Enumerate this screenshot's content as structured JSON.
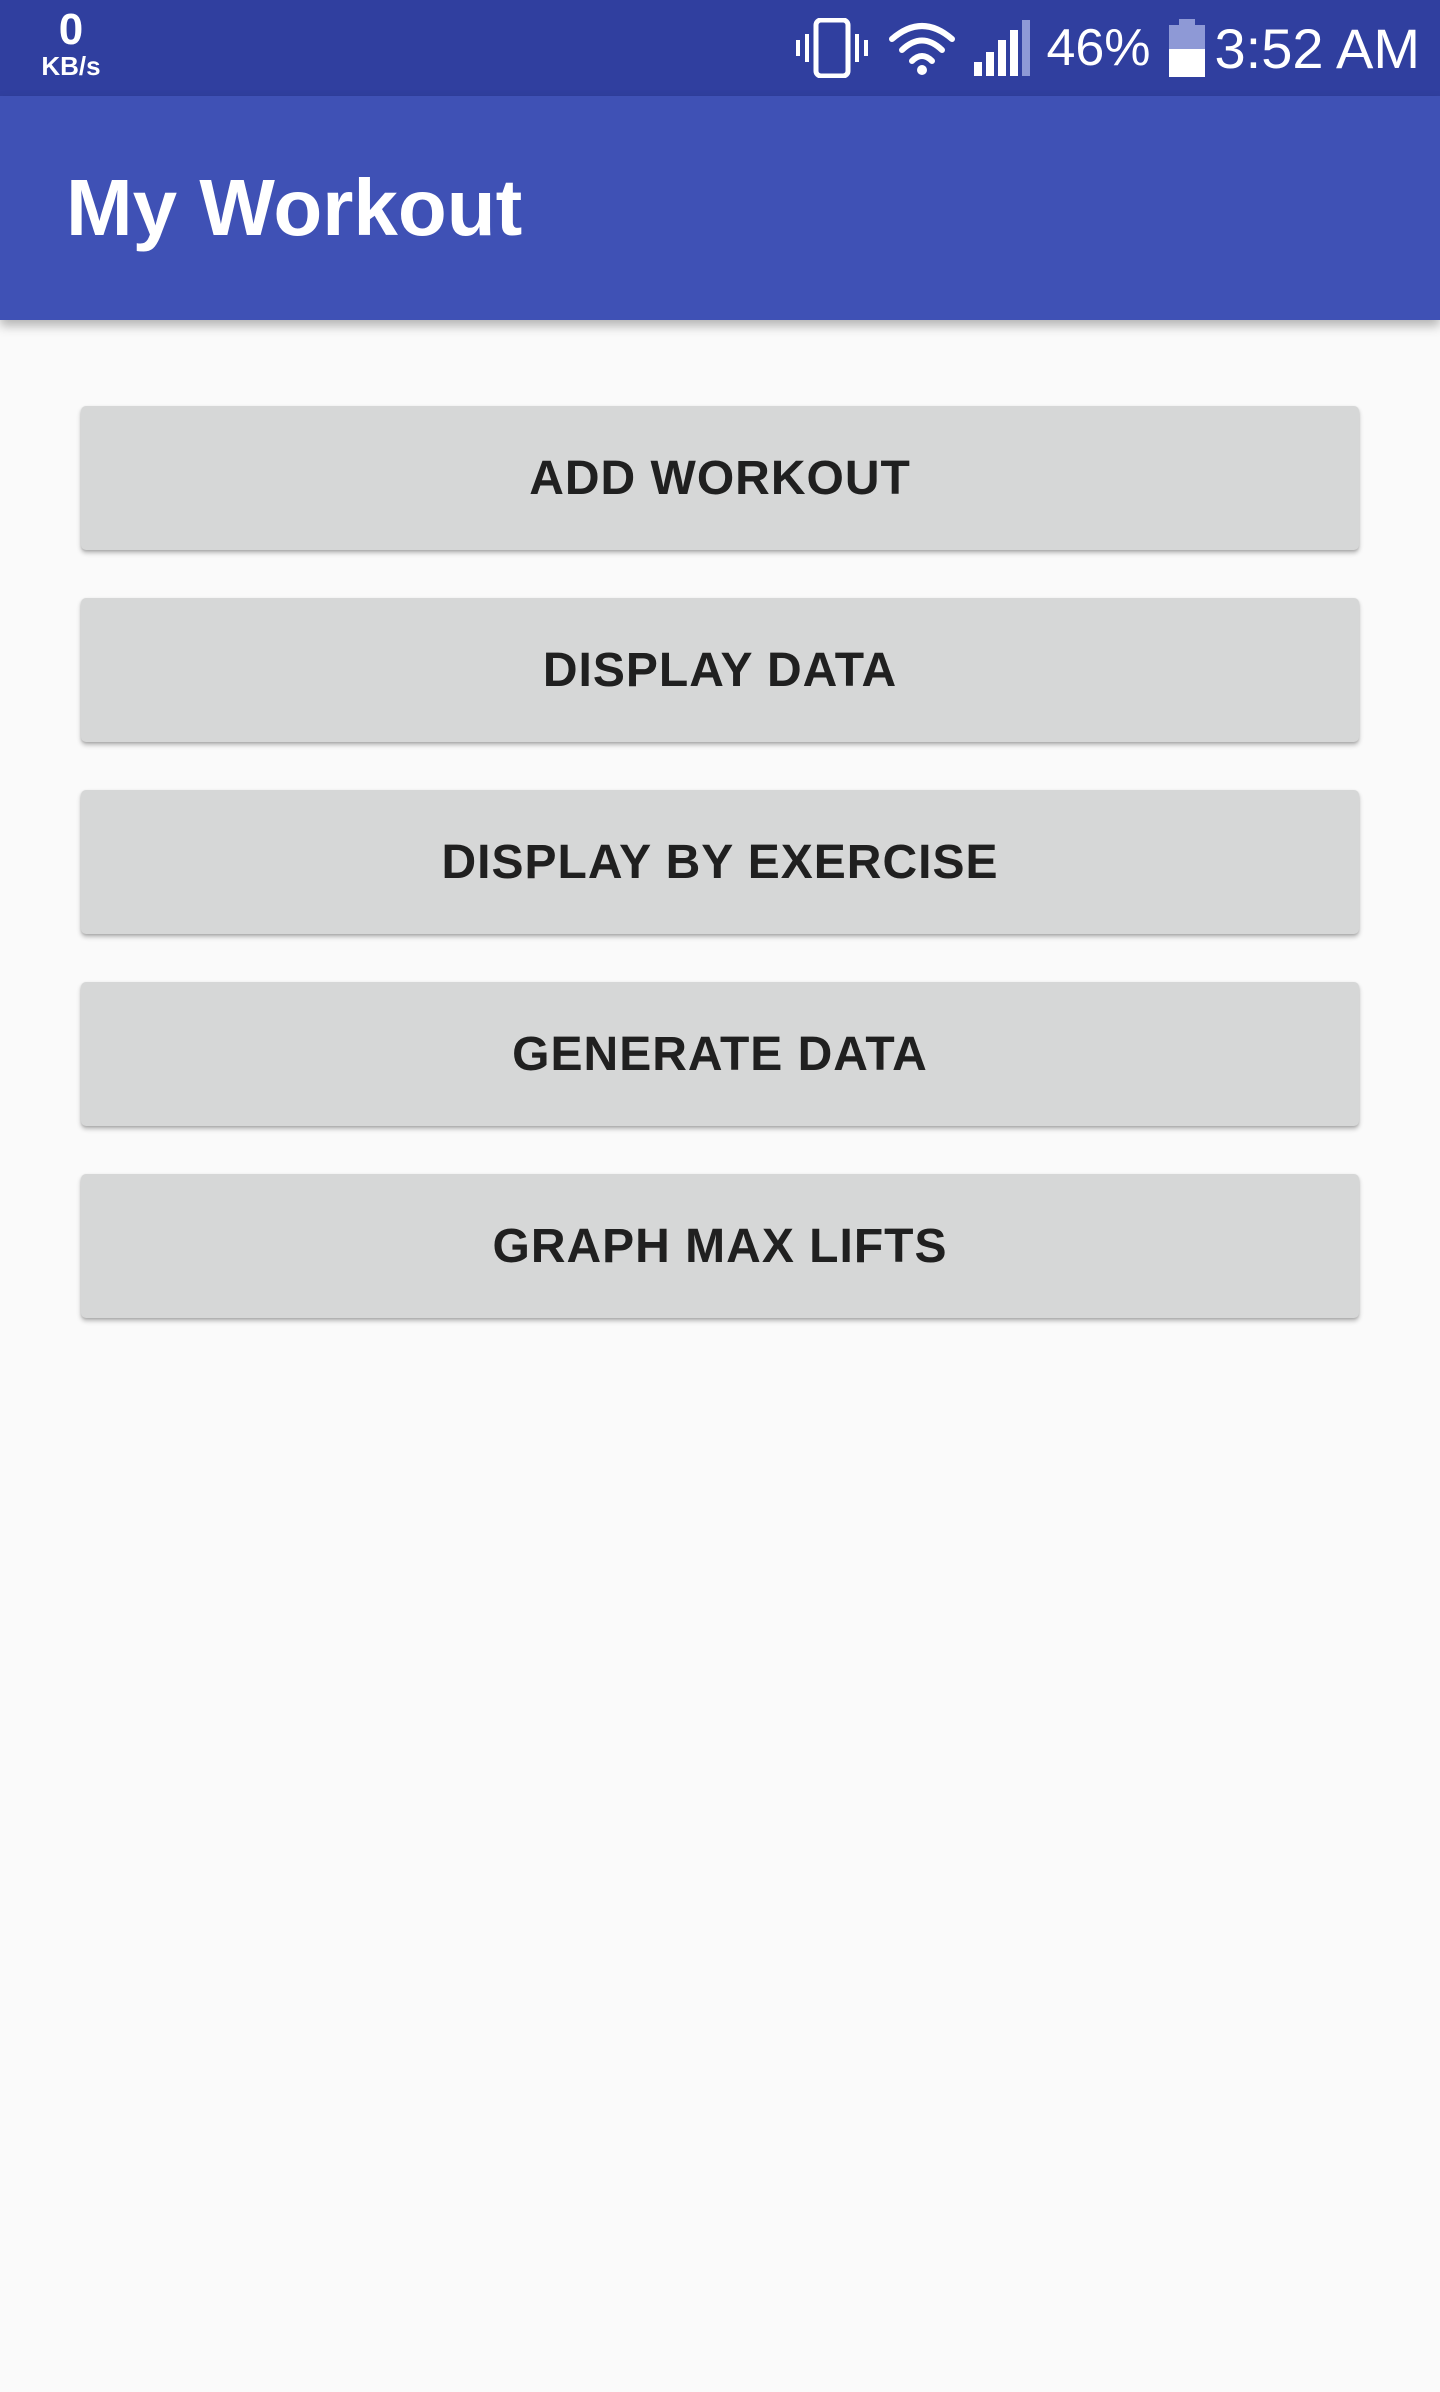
{
  "status_bar": {
    "net_speed_value": "0",
    "net_speed_unit": "KB/s",
    "icons": [
      "vibrate-icon",
      "wifi-icon",
      "cell-signal-icon",
      "battery-icon"
    ],
    "battery_percent": "46%",
    "time": "3:52 AM"
  },
  "app_bar": {
    "title": "My Workout"
  },
  "main": {
    "buttons": [
      {
        "label": "ADD WORKOUT"
      },
      {
        "label": "DISPLAY DATA"
      },
      {
        "label": "DISPLAY BY EXERCISE"
      },
      {
        "label": "GENERATE DATA"
      },
      {
        "label": "GRAPH MAX LIFTS"
      }
    ]
  },
  "colors": {
    "status_bar": "#303f9f",
    "app_bar": "#3f51b5",
    "button_bg": "#d6d7d7",
    "page_bg": "#fafafa"
  }
}
